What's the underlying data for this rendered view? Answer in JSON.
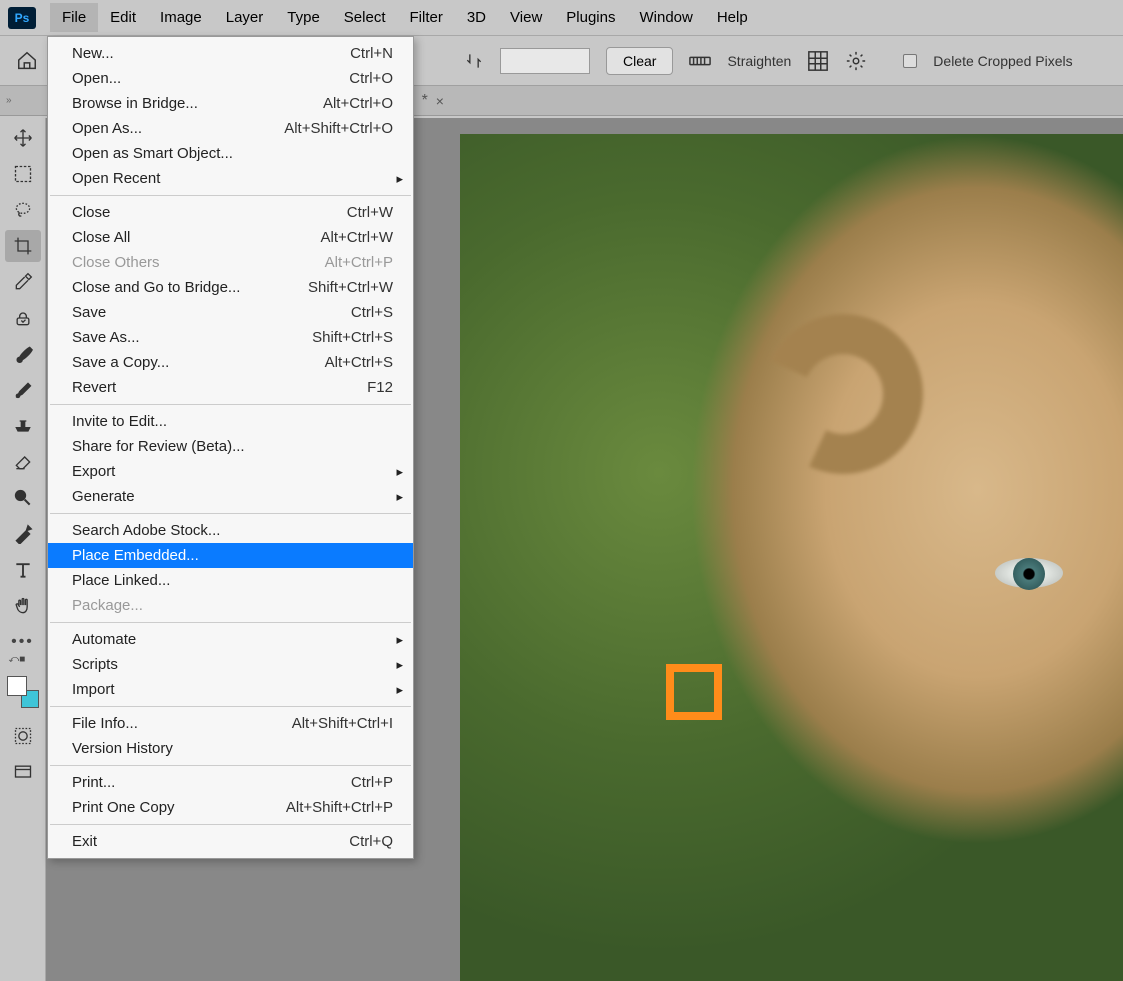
{
  "app": {
    "icon_label": "Ps"
  },
  "menubar": {
    "items": [
      "File",
      "Edit",
      "Image",
      "Layer",
      "Type",
      "Select",
      "Filter",
      "3D",
      "View",
      "Plugins",
      "Window",
      "Help"
    ],
    "active_index": 0
  },
  "options_bar": {
    "clear_label": "Clear",
    "straighten_label": "Straighten",
    "delete_cropped_label": "Delete Cropped Pixels"
  },
  "tab": {
    "modified_marker": "*",
    "close_marker": "×"
  },
  "dropdown": {
    "groups": [
      [
        {
          "label": "New...",
          "shortcut": "Ctrl+N"
        },
        {
          "label": "Open...",
          "shortcut": "Ctrl+O"
        },
        {
          "label": "Browse in Bridge...",
          "shortcut": "Alt+Ctrl+O"
        },
        {
          "label": "Open As...",
          "shortcut": "Alt+Shift+Ctrl+O"
        },
        {
          "label": "Open as Smart Object..."
        },
        {
          "label": "Open Recent",
          "submenu": true
        }
      ],
      [
        {
          "label": "Close",
          "shortcut": "Ctrl+W"
        },
        {
          "label": "Close All",
          "shortcut": "Alt+Ctrl+W"
        },
        {
          "label": "Close Others",
          "shortcut": "Alt+Ctrl+P",
          "disabled": true
        },
        {
          "label": "Close and Go to Bridge...",
          "shortcut": "Shift+Ctrl+W"
        },
        {
          "label": "Save",
          "shortcut": "Ctrl+S"
        },
        {
          "label": "Save As...",
          "shortcut": "Shift+Ctrl+S"
        },
        {
          "label": "Save a Copy...",
          "shortcut": "Alt+Ctrl+S"
        },
        {
          "label": "Revert",
          "shortcut": "F12"
        }
      ],
      [
        {
          "label": "Invite to Edit..."
        },
        {
          "label": "Share for Review (Beta)..."
        },
        {
          "label": "Export",
          "submenu": true
        },
        {
          "label": "Generate",
          "submenu": true
        }
      ],
      [
        {
          "label": "Search Adobe Stock..."
        },
        {
          "label": "Place Embedded...",
          "highlighted": true
        },
        {
          "label": "Place Linked..."
        },
        {
          "label": "Package...",
          "disabled": true
        }
      ],
      [
        {
          "label": "Automate",
          "submenu": true
        },
        {
          "label": "Scripts",
          "submenu": true
        },
        {
          "label": "Import",
          "submenu": true
        }
      ],
      [
        {
          "label": "File Info...",
          "shortcut": "Alt+Shift+Ctrl+I"
        },
        {
          "label": "Version History"
        }
      ],
      [
        {
          "label": "Print...",
          "shortcut": "Ctrl+P"
        },
        {
          "label": "Print One Copy",
          "shortcut": "Alt+Shift+Ctrl+P"
        }
      ],
      [
        {
          "label": "Exit",
          "shortcut": "Ctrl+Q"
        }
      ]
    ]
  },
  "tools": [
    {
      "name": "move-tool"
    },
    {
      "name": "marquee-tool"
    },
    {
      "name": "lasso-tool"
    },
    {
      "name": "crop-tool",
      "selected": true
    },
    {
      "name": "eyedropper-tool"
    },
    {
      "name": "spot-healing-tool"
    },
    {
      "name": "brush-tool"
    },
    {
      "name": "mixer-brush-tool"
    },
    {
      "name": "clone-stamp-tool"
    },
    {
      "name": "eraser-tool"
    },
    {
      "name": "dodge-tool"
    },
    {
      "name": "pen-tool"
    },
    {
      "name": "type-tool"
    },
    {
      "name": "hand-tool"
    },
    {
      "name": "more-tools"
    }
  ]
}
